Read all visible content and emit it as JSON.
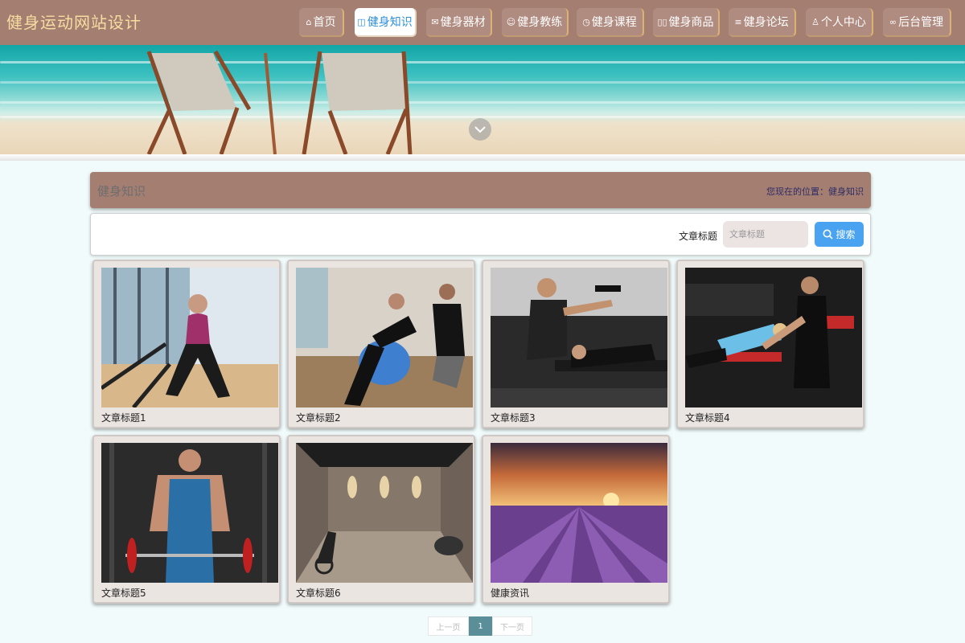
{
  "header": {
    "site_title": "健身运动网站设计",
    "nav": [
      {
        "label": "首页",
        "icon": "home-icon",
        "glyph": "⌂"
      },
      {
        "label": "健身知识",
        "icon": "book-icon",
        "glyph": "◫",
        "active": true
      },
      {
        "label": "健身器材",
        "icon": "mail-icon",
        "glyph": "✉"
      },
      {
        "label": "健身教练",
        "icon": "coach-icon",
        "glyph": "☺"
      },
      {
        "label": "健身课程",
        "icon": "clock-icon",
        "glyph": "◷"
      },
      {
        "label": "健身商品",
        "icon": "grid-icon",
        "glyph": "▯▯"
      },
      {
        "label": "健身论坛",
        "icon": "sliders-icon",
        "glyph": "≡"
      },
      {
        "label": "个人中心",
        "icon": "user-icon",
        "glyph": "♙"
      },
      {
        "label": "后台管理",
        "icon": "link-icon",
        "glyph": "∞"
      }
    ]
  },
  "section": {
    "title": "健身知识",
    "breadcrumb": "您现在的位置：健身知识"
  },
  "search": {
    "label": "文章标题",
    "placeholder": "文章标题",
    "button_label": "搜索"
  },
  "articles": [
    {
      "title": "文章标题1",
      "image": "woman-training-resistance-bands"
    },
    {
      "title": "文章标题2",
      "image": "woman-situps-exercise-ball-with-coach"
    },
    {
      "title": "文章标题3",
      "image": "trainer-spotting-dumbbell-press"
    },
    {
      "title": "文章标题4",
      "image": "trainer-assisting-woman-on-bench"
    },
    {
      "title": "文章标题5",
      "image": "muscular-man-barbell"
    },
    {
      "title": "文章标题6",
      "image": "home-gym-room"
    },
    {
      "title": "健康资讯",
      "image": "lavender-field-sunset"
    }
  ],
  "pagination": {
    "prev_label": "上一页",
    "current_page": "1",
    "next_label": "下一页"
  },
  "colors": {
    "header_bg": "#a57e72",
    "title_color": "#f6dda0",
    "active_tab_text": "#2f8fd8",
    "search_button": "#4aa3f0",
    "page_bg": "#f2fbfb",
    "pager_active": "#5a8f99"
  }
}
